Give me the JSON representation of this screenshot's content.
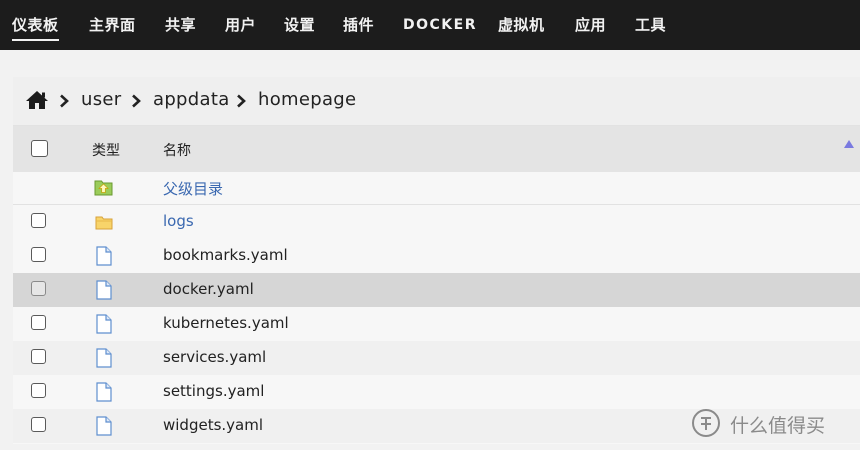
{
  "nav": [
    {
      "label": "仪表板",
      "active": true
    },
    {
      "label": "主界面"
    },
    {
      "label": "共享"
    },
    {
      "label": "用户"
    },
    {
      "label": "设置"
    },
    {
      "label": "插件"
    },
    {
      "label": "DOCKER"
    },
    {
      "label": "虚拟机"
    },
    {
      "label": "应用"
    },
    {
      "label": "工具"
    }
  ],
  "breadcrumb": {
    "home_icon": "home-icon",
    "items": [
      "user",
      "appdata",
      "homepage"
    ]
  },
  "table": {
    "col_type": "类型",
    "col_name": "名称",
    "sort_icon": "sort-ascending-icon",
    "parent": {
      "name": "父级目录",
      "icon": "parent-folder-icon"
    },
    "rows": [
      {
        "name": "logs",
        "icon": "folder-icon"
      },
      {
        "name": "bookmarks.yaml",
        "icon": "file-icon"
      },
      {
        "name": "docker.yaml",
        "icon": "file-icon"
      },
      {
        "name": "kubernetes.yaml",
        "icon": "file-icon"
      },
      {
        "name": "services.yaml",
        "icon": "file-icon"
      },
      {
        "name": "settings.yaml",
        "icon": "file-icon"
      },
      {
        "name": "widgets.yaml",
        "icon": "file-icon"
      }
    ]
  },
  "watermark": {
    "text": "什么值得买"
  },
  "colors": {
    "nav_bg": "#1c1c1c",
    "link": "#3a68b0",
    "folder": "#f2c24e",
    "parent_folder": "#8bc34a",
    "file_outline": "#5f8fcf",
    "row_highlight": "#d6d6d6"
  }
}
